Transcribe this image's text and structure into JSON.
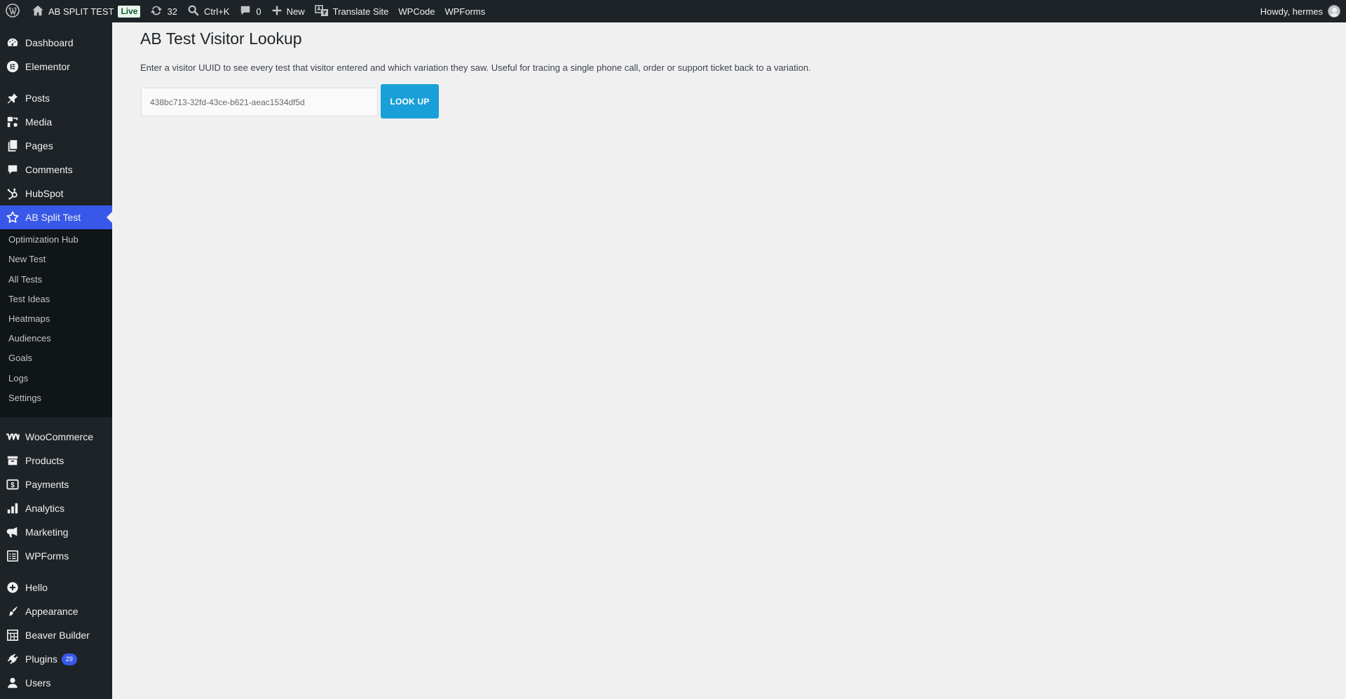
{
  "admin_bar": {
    "site_name": "AB SPLIT TEST",
    "live_badge": "Live",
    "updates_count": "32",
    "search_shortcut": "Ctrl+K",
    "comments_count": "0",
    "new_label": "New",
    "translate_label": "Translate Site",
    "wpcode_label": "WPCode",
    "wpforms_label": "WPForms",
    "greeting": "Howdy, hermes"
  },
  "sidebar": {
    "items": [
      {
        "label": "Dashboard",
        "icon": "dashboard-icon"
      },
      {
        "label": "Elementor",
        "icon": "elementor-icon"
      },
      {
        "label": "Posts",
        "icon": "pin-icon"
      },
      {
        "label": "Media",
        "icon": "media-icon"
      },
      {
        "label": "Pages",
        "icon": "pages-icon"
      },
      {
        "label": "Comments",
        "icon": "comment-icon"
      },
      {
        "label": "HubSpot",
        "icon": "hubspot-icon"
      },
      {
        "label": "AB Split Test",
        "icon": "star-icon"
      },
      {
        "label": "WooCommerce",
        "icon": "woocommerce-icon"
      },
      {
        "label": "Products",
        "icon": "archive-icon"
      },
      {
        "label": "Payments",
        "icon": "dollar-icon"
      },
      {
        "label": "Analytics",
        "icon": "bar-chart-icon"
      },
      {
        "label": "Marketing",
        "icon": "megaphone-icon"
      },
      {
        "label": "WPForms",
        "icon": "forms-icon"
      },
      {
        "label": "Hello",
        "icon": "plus-circle-icon"
      },
      {
        "label": "Appearance",
        "icon": "brush-icon"
      },
      {
        "label": "Beaver Builder",
        "icon": "grid-icon"
      },
      {
        "label": "Plugins",
        "icon": "plug-icon",
        "badge": "29"
      },
      {
        "label": "Users",
        "icon": "user-icon"
      }
    ],
    "submenu": [
      "Optimization Hub",
      "New Test",
      "All Tests",
      "Test Ideas",
      "Heatmaps",
      "Audiences",
      "Goals",
      "Logs",
      "Settings"
    ]
  },
  "main": {
    "title": "AB Test Visitor Lookup",
    "description": "Enter a visitor UUID to see every test that visitor entered and which variation they saw. Useful for tracing a single phone call, order or support ticket back to a variation.",
    "uuid_placeholder": "438bc713-32fd-43ce-b621-aeac1534df5d",
    "lookup_button": "LOOK UP"
  },
  "colors": {
    "admin_bg": "#1d2327",
    "current_menu": "#3858e9",
    "submenu_bg": "#101517",
    "button_bg": "#1aa0d8",
    "page_bg": "#f0f0f1",
    "live_badge_bg": "#e8f7ec"
  }
}
